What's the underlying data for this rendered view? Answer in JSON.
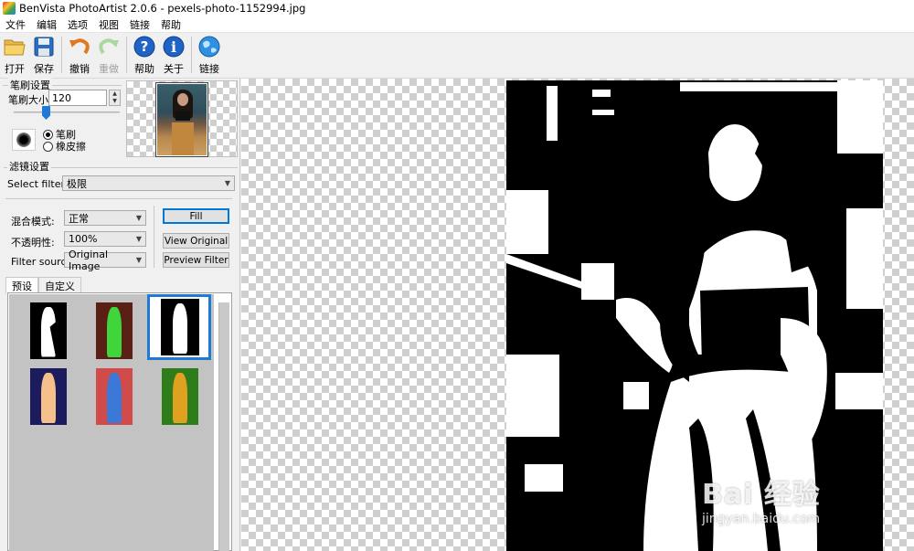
{
  "window": {
    "title": "BenVista PhotoArtist 2.0.6 - pexels-photo-1152994.jpg"
  },
  "menu": [
    "文件",
    "编辑",
    "选项",
    "视图",
    "链接",
    "帮助"
  ],
  "toolbar": {
    "open": {
      "label": "打开",
      "icon": "folder-open-icon"
    },
    "save": {
      "label": "保存",
      "icon": "floppy-disk-icon"
    },
    "undo": {
      "label": "撤销",
      "icon": "undo-arrow-icon"
    },
    "redo": {
      "label": "重做",
      "icon": "redo-arrow-icon"
    },
    "help": {
      "label": "帮助",
      "icon": "question-icon"
    },
    "about": {
      "label": "关于",
      "icon": "info-icon"
    },
    "link": {
      "label": "链接",
      "icon": "globe-icon"
    }
  },
  "brush": {
    "group_title": "笔刷设置",
    "size_label": "笔刷大小",
    "size_value": "120",
    "mode_brush": "笔刷",
    "mode_eraser": "橡皮擦",
    "selected_mode": "brush"
  },
  "filter": {
    "group_title": "滤镜设置",
    "select_label": "Select filter:",
    "selected": "极限",
    "blend_label": "混合模式:",
    "blend_value": "正常",
    "opacity_label": "不透明性:",
    "opacity_value": "100%",
    "source_label": "Filter source:",
    "source_value": "Original Image",
    "fill_button": "Fill",
    "view_original_button": "View Original",
    "preview_filter_button": "Preview Filter"
  },
  "tabs": {
    "presets": "预设",
    "custom": "自定义",
    "active": "presets"
  },
  "watermark": {
    "brand": "Bai 经验",
    "url": "jingyan.baidu.com"
  },
  "colors": {
    "accent": "#1e7ad4",
    "toolbar_bg": "#f0f0f0",
    "preset_bg": "#c3c3c3"
  }
}
